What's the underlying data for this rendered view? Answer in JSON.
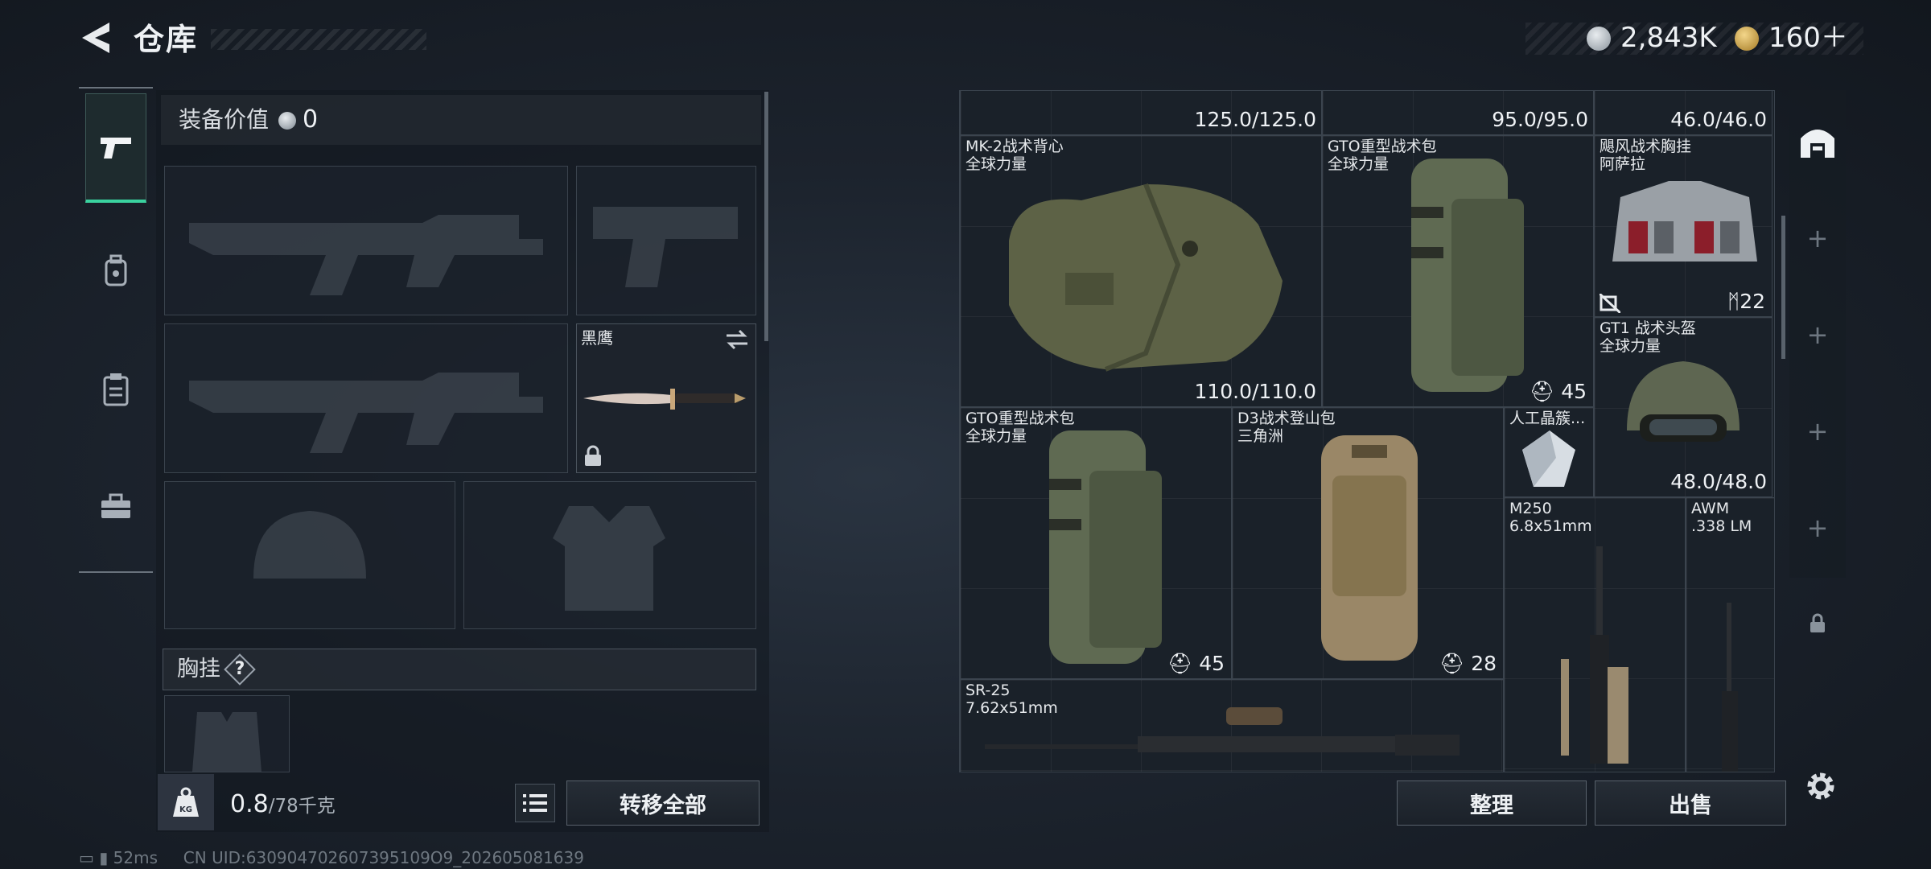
{
  "header": {
    "title": "仓库",
    "currency_1": "2,843K",
    "currency_2": "160＋"
  },
  "left_tabs": [
    "weapon-pistol-icon",
    "helmet-bag-icon",
    "chest-rig-icon",
    "toolbox-icon"
  ],
  "loadout": {
    "value_label": "装备价值",
    "value": "0",
    "melee_name": "黑鹰",
    "chest_rig_label": "胸挂",
    "chest_rig_help": "?",
    "weight": "0.8",
    "weight_max": "/78千克",
    "transfer_all": "转移全部"
  },
  "inventory": {
    "top_row": [
      {
        "durability": "125.0/125.0"
      },
      {
        "durability": "95.0/95.0"
      },
      {
        "durability": "46.0/46.0"
      }
    ],
    "items": [
      {
        "name": "MK-2战术背心",
        "sub": "全球力量",
        "durability": "110.0/110.0"
      },
      {
        "name": "GTO重型战术包",
        "sub": "全球力量",
        "count": "45"
      },
      {
        "name": "飓风战术胸挂",
        "sub": "阿萨拉",
        "count": "22"
      },
      {
        "name": "GT1 战术头盔",
        "sub": "全球力量",
        "durability": "48.0/48.0"
      },
      {
        "name": "GTO重型战术包",
        "sub": "全球力量",
        "count": "45"
      },
      {
        "name": "D3战术登山包",
        "sub": "三角洲",
        "count": "28"
      },
      {
        "name": "人工晶簇...",
        "sub": ""
      },
      {
        "name": "M250",
        "sub": "6.8x51mm"
      },
      {
        "name": "AWM",
        "sub": ".338 LM"
      },
      {
        "name": "SR-25",
        "sub": "7.62x51mm"
      }
    ],
    "sort": "整理",
    "sell": "出售"
  },
  "status": {
    "ping": "52ms",
    "uid": "CN UID:630904702607395109O9_202605081639"
  },
  "colors": {
    "accent": "#3ad29f",
    "rarity_red": "#4a2a31",
    "rarity_blue": "#2c3042",
    "rarity_brown": "#3a3129"
  }
}
